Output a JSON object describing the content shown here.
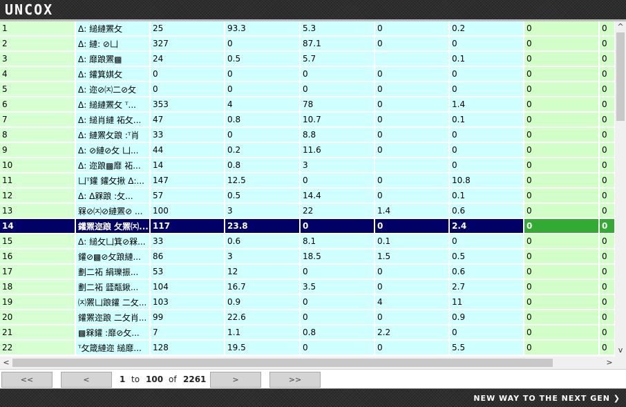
{
  "app": {
    "logo": "UNCOX",
    "tagline": "NEW WAY TO THE NEXT GEN ❯"
  },
  "rows": [
    [
      "1",
      "Δ: 縋縺罴攵",
      "25",
      "93.3",
      "5.3",
      "0",
      "0.2",
      "0",
      "0"
    ],
    [
      "2",
      "Δ: 縺: ⊘凵",
      "327",
      "0",
      "87.1",
      "0",
      "0",
      "0",
      "0"
    ],
    [
      "3",
      "Δ: 靡踉罴▩",
      "24",
      "0.5",
      "5.7",
      "",
      "0.1",
      "0",
      "0"
    ],
    [
      "4",
      "Δ: 鑵箕娸攵",
      "0",
      "0",
      "0",
      "0",
      "0",
      "0",
      "0"
    ],
    [
      "5",
      "Δ: 迩⊘㈈二⊘攵",
      "0",
      "0",
      "0",
      "0",
      "0",
      "0",
      "0"
    ],
    [
      "6",
      "Δ: 縋縺罴攵 ᵀ...",
      "353",
      "4",
      "78",
      "0",
      "1.4",
      "0",
      "0"
    ],
    [
      "7",
      "Δ: 縋肖縺 祏攵...",
      "47",
      "0.8",
      "10.7",
      "0",
      "0.1",
      "0",
      "0"
    ],
    [
      "8",
      "Δ: 縺罴攵踉 :ᵀ肖",
      "33",
      "0",
      "8.8",
      "0",
      "0",
      "0",
      "0"
    ],
    [
      "9",
      "Δ: ⊘縺⊘攵 凵...",
      "44",
      "0.2",
      "11.6",
      "0",
      "0",
      "0",
      "0"
    ],
    [
      "10",
      "Δ: 迩踉▩靡 祏...",
      "14",
      "0.8",
      "3",
      "",
      "0",
      "0",
      "0"
    ],
    [
      "11",
      "凵ᵀ鑵 鑵攵揪 Δ:...",
      "147",
      "12.5",
      "0",
      "0",
      "10.8",
      "0",
      "0"
    ],
    [
      "12",
      "Δ: Δ槑踉 :攵...",
      "57",
      "0.5",
      "14.4",
      "0",
      "0.1",
      "0",
      "0"
    ],
    [
      "13",
      "槑⊘㈈⊘縺罴⊘ ...",
      "100",
      "3",
      "22",
      "1.4",
      "0.6",
      "0",
      "0"
    ],
    [
      "14",
      "鑵罴迩踉 攵罴㈈...",
      "117",
      "23.8",
      "0",
      "0",
      "2.4",
      "0",
      "0"
    ],
    [
      "15",
      "Δ: 縋攵凵箕⊘槑...",
      "33",
      "0.6",
      "8.1",
      "0.1",
      "0",
      "0",
      "0"
    ],
    [
      "16",
      "鑵⊘▩⊘攵踉縺...",
      "86",
      "3",
      "18.5",
      "1.5",
      "0.5",
      "0",
      "0"
    ],
    [
      "17",
      "劃二祏 絹瓅振...",
      "53",
      "12",
      "0",
      "0",
      "0.6",
      "0",
      "0"
    ],
    [
      "18",
      "劃二祏 瓥甐鍬...",
      "104",
      "16.7",
      "3.5",
      "0",
      "2.7",
      "0",
      "0"
    ],
    [
      "19",
      "㈈罴凵踉鑵 二攵...",
      "103",
      "0.9",
      "0",
      "4",
      "11",
      "0",
      "0"
    ],
    [
      "20",
      "鑵罴迩踉 二攵肖...",
      "99",
      "22.6",
      "0",
      "0",
      "0.9",
      "0",
      "0"
    ],
    [
      "21",
      "▩槑鑵 :靡⊘攵...",
      "7",
      "1.1",
      "0.8",
      "2.2",
      "0",
      "0",
      "0"
    ],
    [
      "22",
      "ᵀ攵箴縺迩 縋靡...",
      "128",
      "19.5",
      "0",
      "0",
      "5.5",
      "0",
      "0"
    ]
  ],
  "selected_row_index": 13,
  "pager": {
    "first_label": "<<",
    "prev_label": "<",
    "next_label": ">",
    "last_label": ">>",
    "from": "1",
    "to_word": "to",
    "to": "100",
    "of_word": "of",
    "total": "2261"
  },
  "colors": {
    "cell_cyan": "#d0ffff",
    "cell_green": "#d2ffc8",
    "selected_row": "#000066",
    "selected_green": "#33aa33"
  }
}
